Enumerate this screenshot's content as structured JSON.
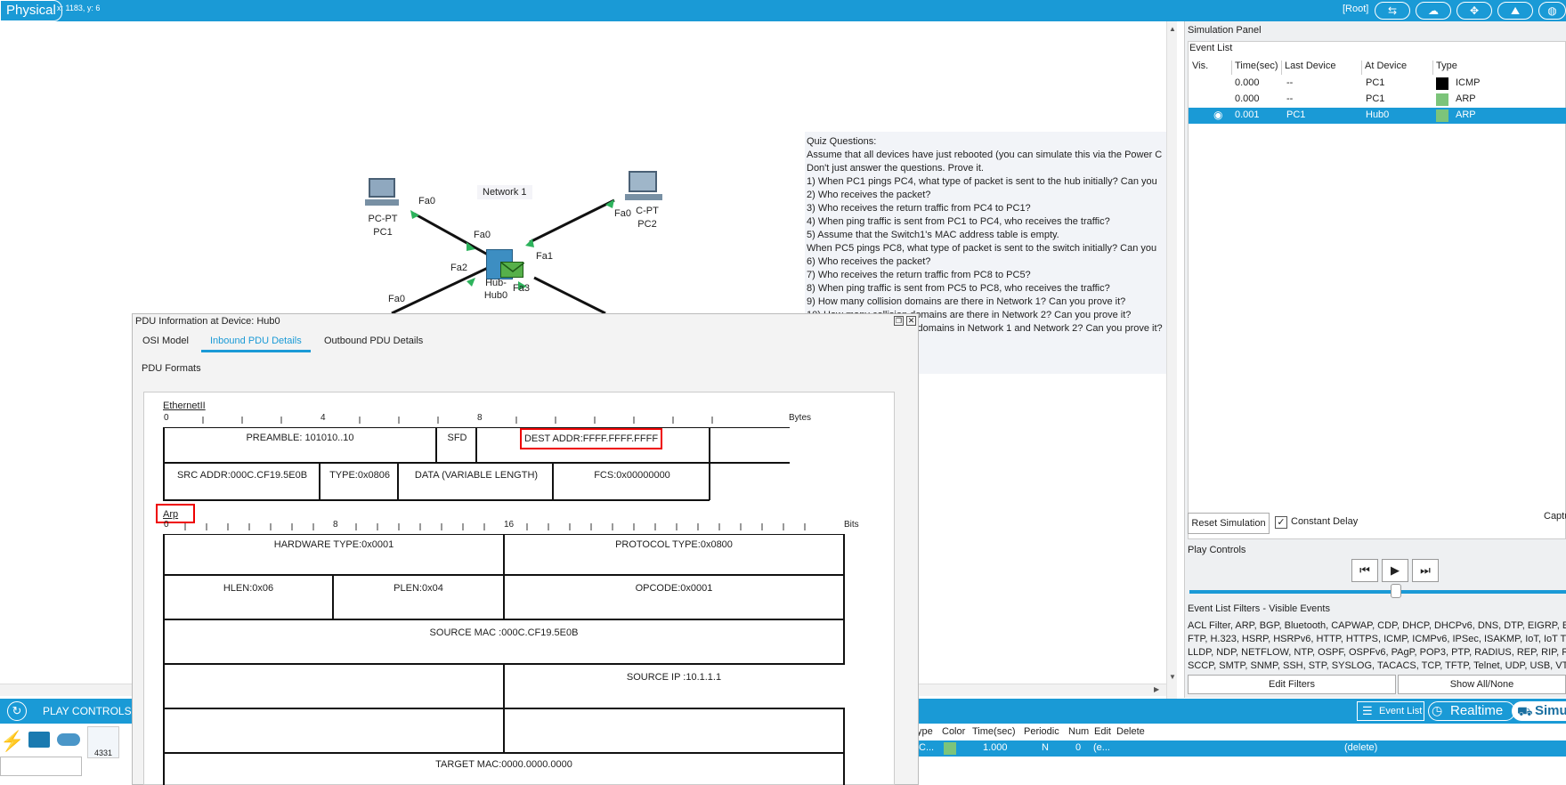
{
  "topbar": {
    "mode": "Physical",
    "coordinates": "x: 1183, y: 6",
    "root": "[Root]"
  },
  "workspace": {
    "network_label": "Network 1",
    "devices": {
      "pc1_model": "PC-PT",
      "pc1_name": "PC1",
      "pc2_model": "C-PT",
      "pc2_name": "PC2",
      "hub_model": "Hub-",
      "hub_name": "Hub0"
    },
    "ports": {
      "pc1_fa0": "Fa0",
      "hub_fa0": "Fa0",
      "hub_fa1": "Fa1",
      "hub_fa2": "Fa2",
      "hub_fa3": "Fa3",
      "pc2_fa0": "Fa0",
      "lower_fa0": "Fa0"
    },
    "quiz": [
      "Quiz Questions:",
      "Assume that all devices have just rebooted (you can simulate this via the Power C",
      "",
      "Don't just answer the questions. Prove it.",
      "1) When PC1 pings PC4, what type of packet is sent to the hub initially? Can you",
      "2) Who receives the packet?",
      "3) Who receives the return traffic from PC4 to PC1?",
      "4) When ping traffic is sent from PC1 to PC4, who receives the traffic?",
      "",
      "5) Assume that the Switch1's MAC address table is empty.",
      "When PC5 pings PC8, what type of packet is sent to the switch initially? Can you",
      "6) Who receives the packet?",
      "7) Who receives the return traffic from PC8 to PC5?",
      "8) When ping traffic is sent from PC5 to PC8, who receives the traffic?",
      "",
      "9) How many collision domains are there in Network 1? Can you prove it?",
      "10) How many collision domains are there in Network 2? Can you prove it?",
      "11) How many broadcast domains in Network 1 and Network 2? Can you prove it?"
    ]
  },
  "simulation_panel": {
    "title": "Simulation Panel",
    "event_list_title": "Event List",
    "columns": [
      "Vis.",
      "Time(sec)",
      "Last Device",
      "At Device",
      "Type"
    ],
    "events": [
      {
        "time": "0.000",
        "last": "--",
        "at": "PC1",
        "type": "ICMP",
        "color": "#000000",
        "selected": false
      },
      {
        "time": "0.000",
        "last": "--",
        "at": "PC1",
        "type": "ARP",
        "color": "#7cc47a",
        "selected": false
      },
      {
        "time": "0.001",
        "last": "PC1",
        "at": "Hub0",
        "type": "ARP",
        "color": "#7cc47a",
        "selected": true
      }
    ],
    "reset_label": "Reset Simulation",
    "constant_delay_label": "Constant Delay",
    "constant_delay_checked": "✓",
    "capture_label": "Captu",
    "play_controls_title": "Play Controls",
    "play_controls": [
      "⏮",
      "▶",
      "⏭"
    ],
    "filters_title": "Event List Filters - Visible Events",
    "filter_lines": [
      "ACL Filter, ARP, BGP, Bluetooth, CAPWAP, CDP, DHCP, DHCPv6, DNS, DTP, EIGRP, EI",
      "FTP, H.323, HSRP, HSRPv6, HTTP, HTTPS, ICMP, ICMPv6, IPSec, ISAKMP, IoT, IoT TC",
      "LLDP, NDP, NETFLOW, NTP, OSPF, OSPFv6, PAgP, POP3, PTP, RADIUS, REP, RIP, RIPn",
      "SCCP, SMTP, SNMP, SSH, STP, SYSLOG, TACACS, TCP, TFTP, Telnet, UDP, USB, VTP"
    ],
    "edit_filters_label": "Edit Filters",
    "show_all_label": "Show All/None"
  },
  "bottom_bar": {
    "play_controls_label": "PLAY CONTROLS",
    "event_list_label": "Event List",
    "realtime_label": "Realtime",
    "simulation_label": "Simu",
    "device_model": "4331"
  },
  "pdu_list": {
    "columns": [
      "ype",
      "Color",
      "Time(sec)",
      "Periodic",
      "Num",
      "Edit",
      "Delete"
    ],
    "row": {
      "type": "C...",
      "time": "1.000",
      "periodic": "N",
      "num": "0",
      "edit": "(e...",
      "delete": "(delete)",
      "color": "#7cc47a"
    }
  },
  "pdu_dialog": {
    "title": "PDU Information at Device: Hub0",
    "tabs": [
      "OSI Model",
      "Inbound PDU Details",
      "Outbound PDU Details"
    ],
    "active_tab": "Inbound PDU Details",
    "formats_label": "PDU Formats",
    "ethernet": {
      "label": "EthernetII",
      "ruler": [
        "0",
        "4",
        "8"
      ],
      "unit": "Bytes",
      "preamble": "PREAMBLE: 101010..10",
      "sfd": "SFD",
      "dest": "DEST ADDR:FFFF.FFFF.FFFF",
      "src": "SRC ADDR:000C.CF19.5E0B",
      "type": "TYPE:0x0806",
      "data": "DATA (VARIABLE LENGTH)",
      "fcs": "FCS:0x00000000"
    },
    "arp": {
      "label": "Arp",
      "ruler": [
        "0",
        "8",
        "16"
      ],
      "unit": "Bits",
      "hw_type": "HARDWARE TYPE:0x0001",
      "proto_type": "PROTOCOL TYPE:0x0800",
      "hlen": "HLEN:0x06",
      "plen": "PLEN:0x04",
      "opcode": "OPCODE:0x0001",
      "src_mac": "SOURCE MAC :000C.CF19.5E0B",
      "src_ip": "SOURCE IP :10.1.1.1",
      "target_mac": "TARGET MAC:0000.0000.0000"
    }
  }
}
